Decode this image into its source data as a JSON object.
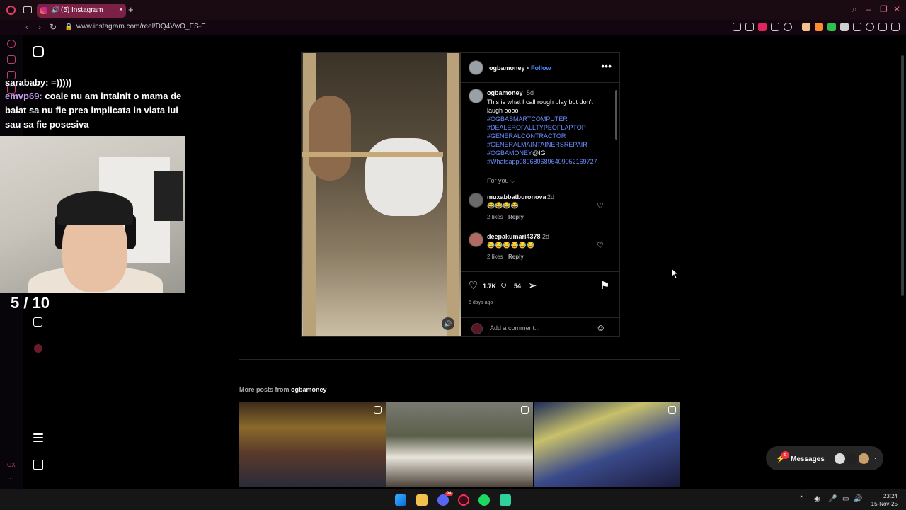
{
  "browser": {
    "tab_title": "(5) Instagram",
    "tab_audio": "🔊",
    "tab_close": "×",
    "new_tab": "+",
    "url": "www.instagram.com/reel/DQ4VwO_ES-E"
  },
  "stream": {
    "chat": [
      {
        "user": "sarababy:",
        "text": " =)))))",
        "color": "#ffffff"
      },
      {
        "user": "emvp69:",
        "text": " coaie nu am intalnit o mama de",
        "color": "#c79df0"
      },
      {
        "user": "",
        "text": "baiat sa nu fie prea implicata in viata lui",
        "color": "#ffffff"
      },
      {
        "user": "",
        "text": "sau sa fie posesiva",
        "color": "#ffffff"
      }
    ],
    "counter": "5 / 10"
  },
  "post": {
    "author": "ogbamoney",
    "follow_sep": "•",
    "follow": "Follow",
    "caption_author": "ogbamoney",
    "caption_age": "5d",
    "caption_line1": "This is what I call rough play but don't",
    "caption_line2": "laugh oooo",
    "hashtags": [
      "#OGBASMARTCOMPUTER",
      "#DEALEROFALLTYPEOFLAPTOP",
      "#GENERALCONTRACTOR",
      "#GENERALMAINTAINERSREPAIR"
    ],
    "hashtag_last": "#OGBAMONEY",
    "mention": "@IG",
    "whatsapp": "#Whatsapp0806806896409052169727",
    "for_you": "For you ⌵",
    "comments": [
      {
        "user": "muxabbatburonova",
        "age": "2d",
        "text": "😂😂😂😂",
        "likes": "2 likes",
        "reply": "Reply"
      },
      {
        "user": "deepakumari4378",
        "age": "2d",
        "text": "😂😂😂😂😂😂",
        "likes": "2 likes",
        "reply": "Reply"
      }
    ],
    "like_count": "1.7K",
    "comment_count": "54",
    "posted": "5 days ago",
    "add_comment": "Add a comment..."
  },
  "more": {
    "prefix": "More posts from ",
    "author": "ogbamoney"
  },
  "messages": {
    "label": "Messages",
    "badge": "5",
    "more": "···"
  },
  "taskbar": {
    "time": "23:24",
    "date": "15-Nov-25",
    "discord_badge": "94"
  }
}
